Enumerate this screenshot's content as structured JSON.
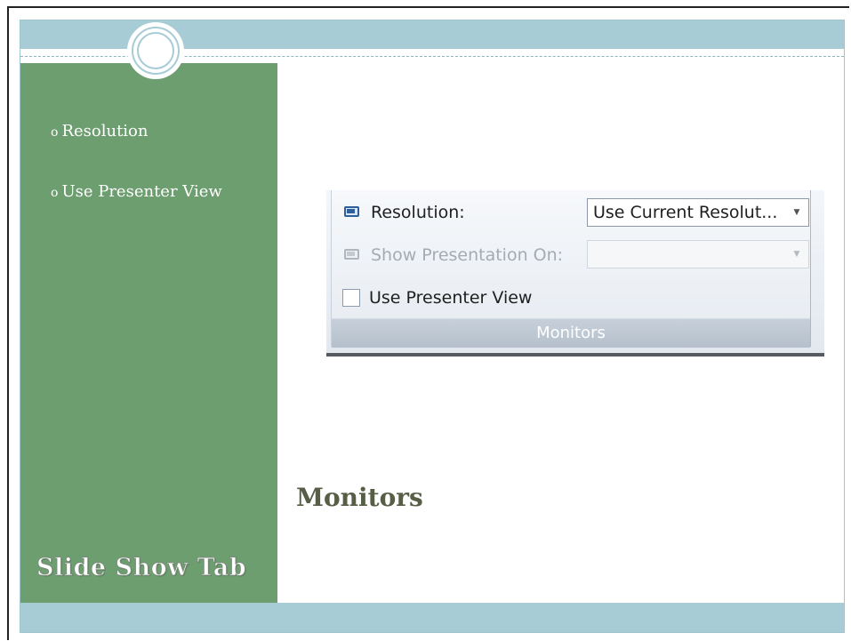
{
  "sidebar": {
    "bullets": [
      "Resolution",
      "Use Presenter View"
    ],
    "bullet_marker": "o",
    "title": "Slide Show Tab"
  },
  "main": {
    "heading": "Monitors"
  },
  "ribbon": {
    "resolution_label": "Resolution:",
    "resolution_value": "Use Current Resolut...",
    "show_on_label": "Show Presentation On:",
    "show_on_value": "",
    "presenter_view_label": "Use Presenter View",
    "presenter_view_checked": false,
    "group_name": "Monitors"
  },
  "colors": {
    "sidebar": "#6d9e70",
    "bars": "#a8ccd5",
    "heading": "#575e46"
  }
}
